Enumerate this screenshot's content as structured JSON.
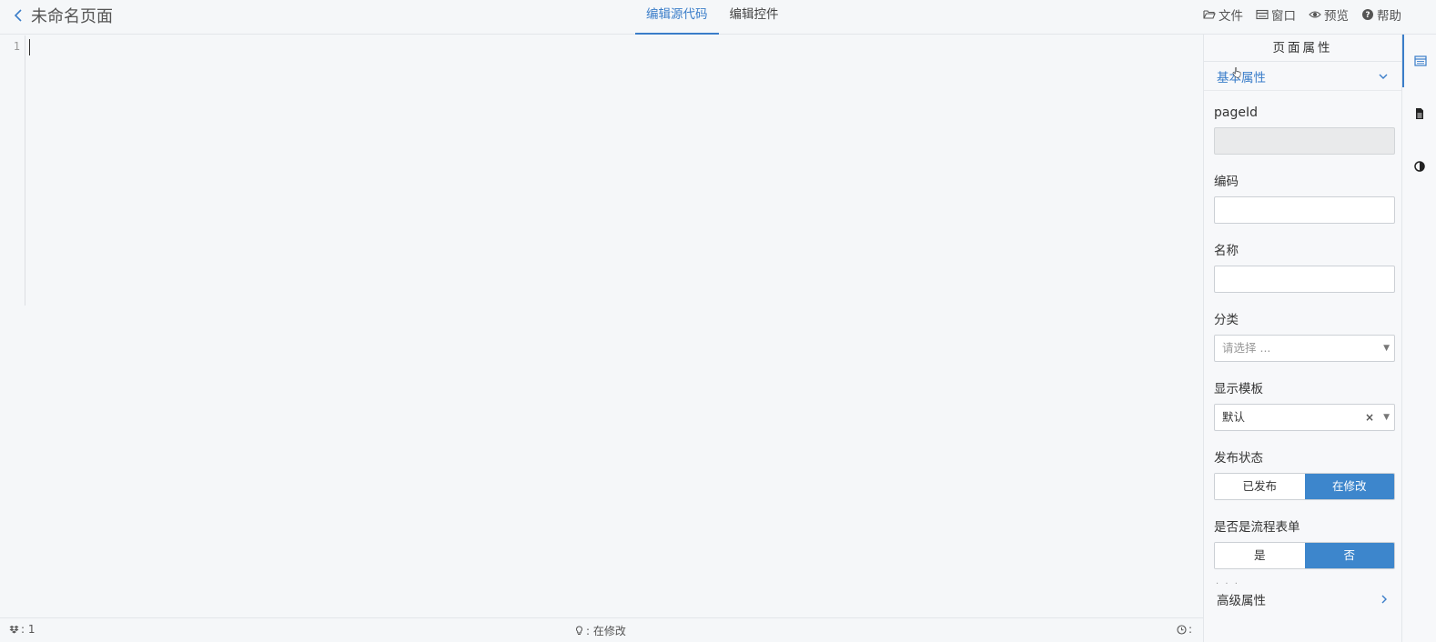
{
  "header": {
    "title": "未命名页面",
    "tabs": [
      {
        "label": "编辑源代码",
        "active": true
      },
      {
        "label": "编辑控件",
        "active": false
      }
    ],
    "menu": {
      "file": "文件",
      "window": "窗口",
      "preview": "预览",
      "help": "帮助"
    }
  },
  "editor": {
    "line_numbers": [
      "1"
    ]
  },
  "statusbar": {
    "left": ": 1",
    "center": ": 在修改",
    "right": ":"
  },
  "panel": {
    "title": "页面属性",
    "section_basic": "基本属性",
    "fields": {
      "pageid_label": "pageId",
      "code_label": "编码",
      "name_label": "名称",
      "category_label": "分类",
      "category_placeholder": "请选择 ...",
      "template_label": "显示模板",
      "template_value": "默认",
      "publish_label": "发布状态",
      "publish_options": [
        "已发布",
        "在修改"
      ],
      "publish_selected": "在修改",
      "flow_label": "是否是流程表单",
      "flow_options": [
        "是",
        "否"
      ],
      "flow_selected": "否"
    },
    "more_dots": ". . .",
    "section_advanced": "高级属性"
  },
  "colors": {
    "accent": "#3a7dc9",
    "button_selected": "#3d86cc",
    "background": "#f5f7f9"
  },
  "icons": {
    "back": "chevron-left-icon",
    "file": "folder-open-icon",
    "window": "window-icon",
    "preview": "eye-icon",
    "help": "question-circle-icon",
    "rail": [
      "table-icon",
      "document-icon",
      "contrast-icon"
    ]
  }
}
